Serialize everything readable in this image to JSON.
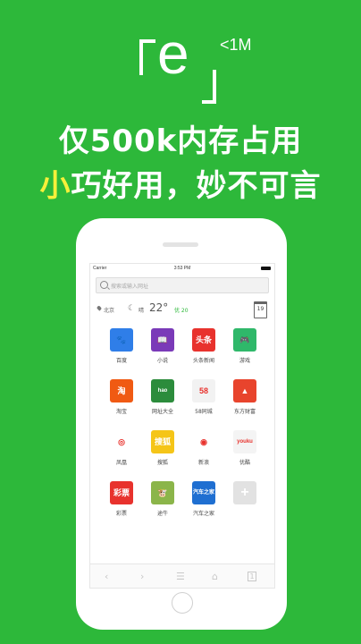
{
  "promo": {
    "logo_letter": "e",
    "size_badge": "<1M",
    "tagline_1": "仅500k内存占用",
    "tagline_2_highlight": "小",
    "tagline_2_rest": "巧好用，妙不可言"
  },
  "status_bar": {
    "carrier": "Carrier",
    "time": "3:53 PM"
  },
  "search": {
    "placeholder": "搜索或输入网址"
  },
  "weather": {
    "city": "北京",
    "condition": "晴",
    "temperature": "22°",
    "air_quality": "优 20",
    "calendar_day": "19"
  },
  "apps": [
    {
      "label": "百度",
      "icon_text": "🐾",
      "color": "#2f7ee8",
      "icon": "baidu-icon"
    },
    {
      "label": "小说",
      "icon_text": "📖",
      "color": "#7a3ab8",
      "icon": "book-icon"
    },
    {
      "label": "头条新闻",
      "icon_text": "头条",
      "color": "#e8322d",
      "icon": "toutiao-icon"
    },
    {
      "label": "游戏",
      "icon_text": "🎮",
      "color": "#2fb86a",
      "icon": "gamepad-icon"
    },
    {
      "label": "淘宝",
      "icon_text": "淘",
      "color": "#f05a13",
      "icon": "taobao-icon"
    },
    {
      "label": "网址大全",
      "icon_text": "hao",
      "color": "#2c8c3c",
      "icon": "hao123-icon"
    },
    {
      "label": "58同城",
      "icon_text": "58",
      "color": "#f2f2f2",
      "icon": "58-icon"
    },
    {
      "label": "东方财富",
      "icon_text": "▲",
      "color": "#e8442d",
      "icon": "eastmoney-icon"
    },
    {
      "label": "凤凰",
      "icon_text": "◎",
      "color": "#ffffff",
      "icon": "ifeng-icon"
    },
    {
      "label": "搜狐",
      "icon_text": "搜狐",
      "color": "#f5c518",
      "icon": "sohu-icon"
    },
    {
      "label": "新浪",
      "icon_text": "◉",
      "color": "#ffffff",
      "icon": "weibo-icon"
    },
    {
      "label": "优酷",
      "icon_text": "youku",
      "color": "#f4f4f4",
      "icon": "youku-icon"
    },
    {
      "label": "彩票",
      "icon_text": "彩票",
      "color": "#e8322d",
      "icon": "lottery-icon"
    },
    {
      "label": "途牛",
      "icon_text": "🐮",
      "color": "#8bb54a",
      "icon": "tuniu-icon"
    },
    {
      "label": "汽车之家",
      "icon_text": "汽车之家",
      "color": "#1f6fd1",
      "icon": "autohome-icon"
    },
    {
      "label": "",
      "icon_text": "+",
      "color": "#e2e2e2",
      "icon": "add-icon"
    }
  ],
  "nav": {
    "back": "‹",
    "forward": "›",
    "menu": "☰",
    "home": "⌂",
    "tabs": "1"
  }
}
